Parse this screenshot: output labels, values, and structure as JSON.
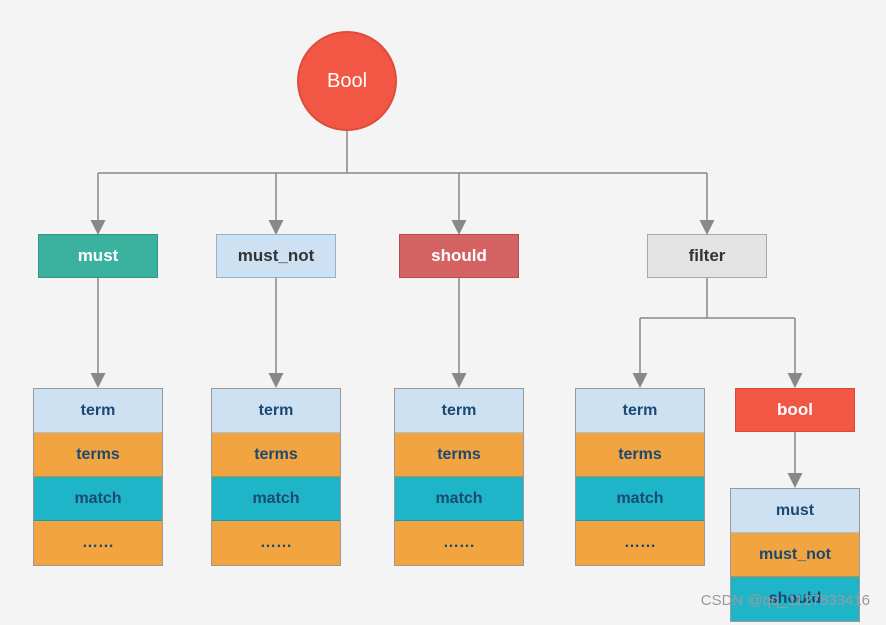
{
  "root": {
    "label": "Bool"
  },
  "branches": [
    {
      "key": "must",
      "label": "must",
      "items": [
        "term",
        "terms",
        "match",
        "……"
      ]
    },
    {
      "key": "must_not",
      "label": "must_not",
      "items": [
        "term",
        "terms",
        "match",
        "……"
      ]
    },
    {
      "key": "should",
      "label": "should",
      "items": [
        "term",
        "terms",
        "match",
        "……"
      ]
    },
    {
      "key": "filter",
      "label": "filter",
      "children": [
        {
          "key": "filter_stack",
          "items": [
            "term",
            "terms",
            "match",
            "……"
          ]
        },
        {
          "key": "bool",
          "label": "bool",
          "items": [
            "must",
            "must_not",
            "should"
          ]
        }
      ]
    }
  ],
  "watermark": "CSDN @qq_1127833416"
}
